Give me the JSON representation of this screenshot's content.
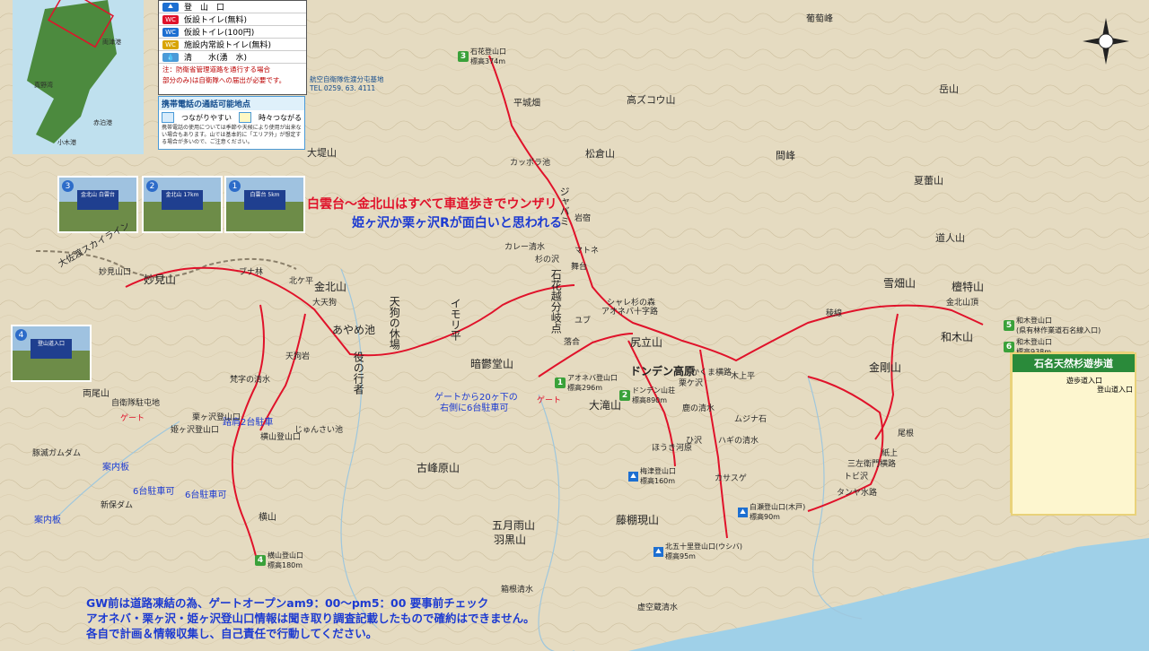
{
  "legend": {
    "rows": [
      {
        "icon": "hiker-icon",
        "color": "#1d6fd1",
        "label": "登　山　口"
      },
      {
        "icon": "toilet-free-icon",
        "color": "#e0122a",
        "icon_text": "WC",
        "label": "仮設トイレ(無料)"
      },
      {
        "icon": "toilet-100-icon",
        "color": "#1d6fd1",
        "icon_text": "WC",
        "label": "仮設トイレ(100円)"
      },
      {
        "icon": "toilet-resident-icon",
        "color": "#d8a400",
        "icon_text": "WC",
        "label": "施設内常設トイレ(無料)"
      },
      {
        "icon": "water-icon",
        "color": "#4a9ad8",
        "label": "清　　水(湧　水)"
      }
    ],
    "road_note_1": "注：防衛省管理道路を通行する場合",
    "road_note_2": "部分のみ)は自衛隊への届出が必要です。",
    "contact_name": "航空自衛隊佐渡分屯基地",
    "contact_phone": "TEL 0259. 63. 4111"
  },
  "phone_box": {
    "title": "携帯電話の通話可能地点",
    "good": "つながりやすい",
    "sometimes": "時々つながる",
    "note": "携帯電話の使用については季節や天候により使用が出来ない場合もあります。山では基本的に「エリア外」が想定する場合が多いので、ご注意ください。"
  },
  "inset_map": {
    "labels": [
      "両津港",
      "真野湾",
      "赤泊港",
      "小木港"
    ]
  },
  "photos": [
    {
      "num": "3",
      "sign": "金北山 白雲台"
    },
    {
      "num": "2",
      "sign": "金北山 17km"
    },
    {
      "num": "1",
      "sign": "白雲台 5km"
    },
    {
      "num": "4",
      "sign": "登山道入口"
    }
  ],
  "annotations": {
    "red_1": "白雲台〜金北山はすべて車道歩きでウンザリ",
    "blue_1": "姫ヶ沢か栗ヶ沢Rが面白いと思われる",
    "gate_note_1": "ゲートから20ヶ下の",
    "gate_note_2": "右側に6台駐車可",
    "parking_2": "路肩2台駐車",
    "sign_board_1": "案内板",
    "parking_6a": "6台駐車可",
    "parking_6b": "6台駐車可",
    "sign_board_2": "案内板",
    "gate_left": "ゲート",
    "gate_mid": "ゲート"
  },
  "trailheads": [
    {
      "num": "3",
      "name": "石花登山口",
      "elev": "標高374m"
    },
    {
      "num": "1",
      "name": "アオネバ登山口",
      "elev": "標高296m"
    },
    {
      "num": "2",
      "name": "ドンデン山荘",
      "elev": "標高890m"
    },
    {
      "num": "4",
      "name": "横山登山口",
      "elev": "標高180m"
    },
    {
      "num": "5",
      "name": "和木登山口",
      "elev": "(県有林作業道石名線入口)"
    },
    {
      "num": "6",
      "name": "和木登山口",
      "elev": "標高938m"
    },
    {
      "num": "",
      "name": "梅津登山口",
      "elev": "標高160m"
    },
    {
      "num": "",
      "name": "北五十里登山口(ウシバ)",
      "elev": "標高95m"
    },
    {
      "num": "",
      "name": "白瀬登山口(木戸)",
      "elev": "標高90m"
    }
  ],
  "peaks": [
    "金北山",
    "妙見山",
    "天狗の休場",
    "役の行者",
    "あやめ池",
    "石花越分岐点",
    "イモリ平",
    "尻立山",
    "ドンデン高原",
    "金剛山",
    "雪畑山",
    "檀特山",
    "和木山",
    "大滝山",
    "暗鬱堂山",
    "古峰原山",
    "五月雨山",
    "羽黒山",
    "藤棚現山",
    "平城畑",
    "松倉山",
    "高ズコウ山",
    "ジャバミ",
    "大堤山",
    "岳山",
    "間峰",
    "夏蕾山",
    "道人山",
    "葡萄峰",
    "横山",
    "両尾山",
    "大天狗",
    "天狗岩",
    "北ケ平",
    "カッポラ池",
    "マトネ",
    "舞台",
    "ブナ林",
    "梵字の清水",
    "じゅんさい池",
    "横山登山口",
    "姫ヶ沢登山口",
    "栗ヶ沢登山口",
    "杉の沢",
    "岩宿",
    "カレー清水",
    "ユブ",
    "落合",
    "アオネバ十字路",
    "シャレ杉の森",
    "金北山頂",
    "稜線",
    "尾根",
    "カサスゲ",
    "トビ沢",
    "タンヤ水路",
    "三左衛門横路",
    "紙上",
    "ひ沢",
    "新保ダム",
    "豚滅ガムダム",
    "自衛隊駐屯地",
    "大佐渡スカイライン",
    "妙見山口",
    "箱根清水",
    "虚空蔵清水",
    "栗ケ沢",
    "鹿の清水",
    "ほうき河原",
    "木上平",
    "ムジナ石",
    "ハギの清水",
    "かくま横路"
  ],
  "route_names": [
    "天狗の休場",
    "役の行者",
    "石花越分岐点",
    "イモリ平",
    "あやめ池"
  ],
  "trees_box": {
    "title": "石名天然杉遊歩道",
    "entry_1": "遊歩道入口",
    "entry_2": "登山道入口"
  },
  "bottom_notes": [
    "GW前は道路凍結の為、ゲートオープンam9：00〜pm5：00 要事前チェック",
    "アオネバ・栗ヶ沢・姫ヶ沢登山口情報は聞き取り調査記載したもので確約はできません。",
    "各自で計画＆情報収集し、自己責任で行動してください。"
  ],
  "colors": {
    "trail": "#e0122a",
    "land": "#e7dcc3",
    "sea": "#9fd0e8",
    "note_blue": "#1d3bd1"
  }
}
